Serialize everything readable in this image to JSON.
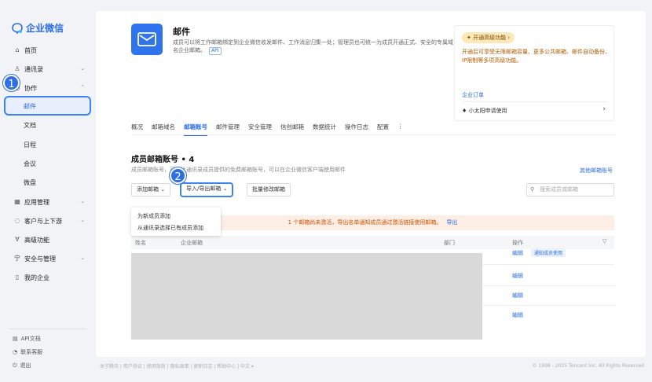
{
  "sidebar": {
    "logo": "企业微信",
    "items": [
      {
        "label": "首页",
        "icon": "home-icon"
      },
      {
        "label": "通讯录",
        "icon": "contacts-icon"
      },
      {
        "label": "协作",
        "icon": "collab-icon"
      },
      {
        "label": "应用管理",
        "icon": "apps-icon"
      },
      {
        "label": "客户与上下游",
        "icon": "customer-icon"
      },
      {
        "label": "高级功能",
        "icon": "advanced-icon"
      },
      {
        "label": "安全与管理",
        "icon": "security-icon"
      },
      {
        "label": "我的企业",
        "icon": "company-icon"
      }
    ],
    "subitems": [
      "邮件",
      "文档",
      "日程",
      "会议",
      "微盘"
    ],
    "footer": [
      "API文档",
      "联系客服",
      "退出"
    ],
    "badge1": "1"
  },
  "app": {
    "title": "邮件",
    "desc": "成员可以将工作邮箱绑定到企业微信收发邮件、工作消息归集一处；管理员也可统一为成员开通正式、安全的专属域名企业邮箱。",
    "api_tag": "API"
  },
  "promo": {
    "tag": "开通高级功能",
    "desc": "开通后可享受无限邮箱容量、更多公共邮箱、邮件自动备份、IP限制等多项高级功能。",
    "section": "企业订单",
    "item": "小太阳申请使用"
  },
  "tabs": [
    "概况",
    "邮箱域名",
    "邮箱账号",
    "邮件管理",
    "安全管理",
    "信创邮箱",
    "数据统计",
    "操作日志",
    "配置",
    "⋮"
  ],
  "section": {
    "title": "成员邮箱账号 • 4",
    "desc": "成员邮箱账号，可以让通讯录成员提供的免费邮箱账号，可以在企业微信客户端使用邮件",
    "other_link": "其他邮箱账号"
  },
  "toolbar": {
    "add": "添加邮箱 ⌄",
    "import": "导入/导出邮箱 ⌄",
    "batch": "批量修改邮箱",
    "search_placeholder": "搜索成员或邮箱",
    "badge2": "2"
  },
  "dropdown": [
    "为新成员添加",
    "从通讯录选择已有成员添加"
  ],
  "alert": {
    "text": "1 个邮箱尚未激活，导出名单通知成员通过激活链接使用邮箱。",
    "link": "导出"
  },
  "table": {
    "headers": [
      "姓名",
      "企业邮箱",
      "部门",
      "操作"
    ],
    "ops": [
      "编辑",
      "编辑",
      "编辑",
      "编辑"
    ],
    "notify": "通知成员使用"
  },
  "footer": {
    "links": "关于腾讯 | 用户协议 | 使用指南 | 隐私政策 | 更新日志 | 帮助中心 | 中文 ▾",
    "copyright": "© 1998 - 2025 Tencent Inc. All Rights Reserved"
  }
}
